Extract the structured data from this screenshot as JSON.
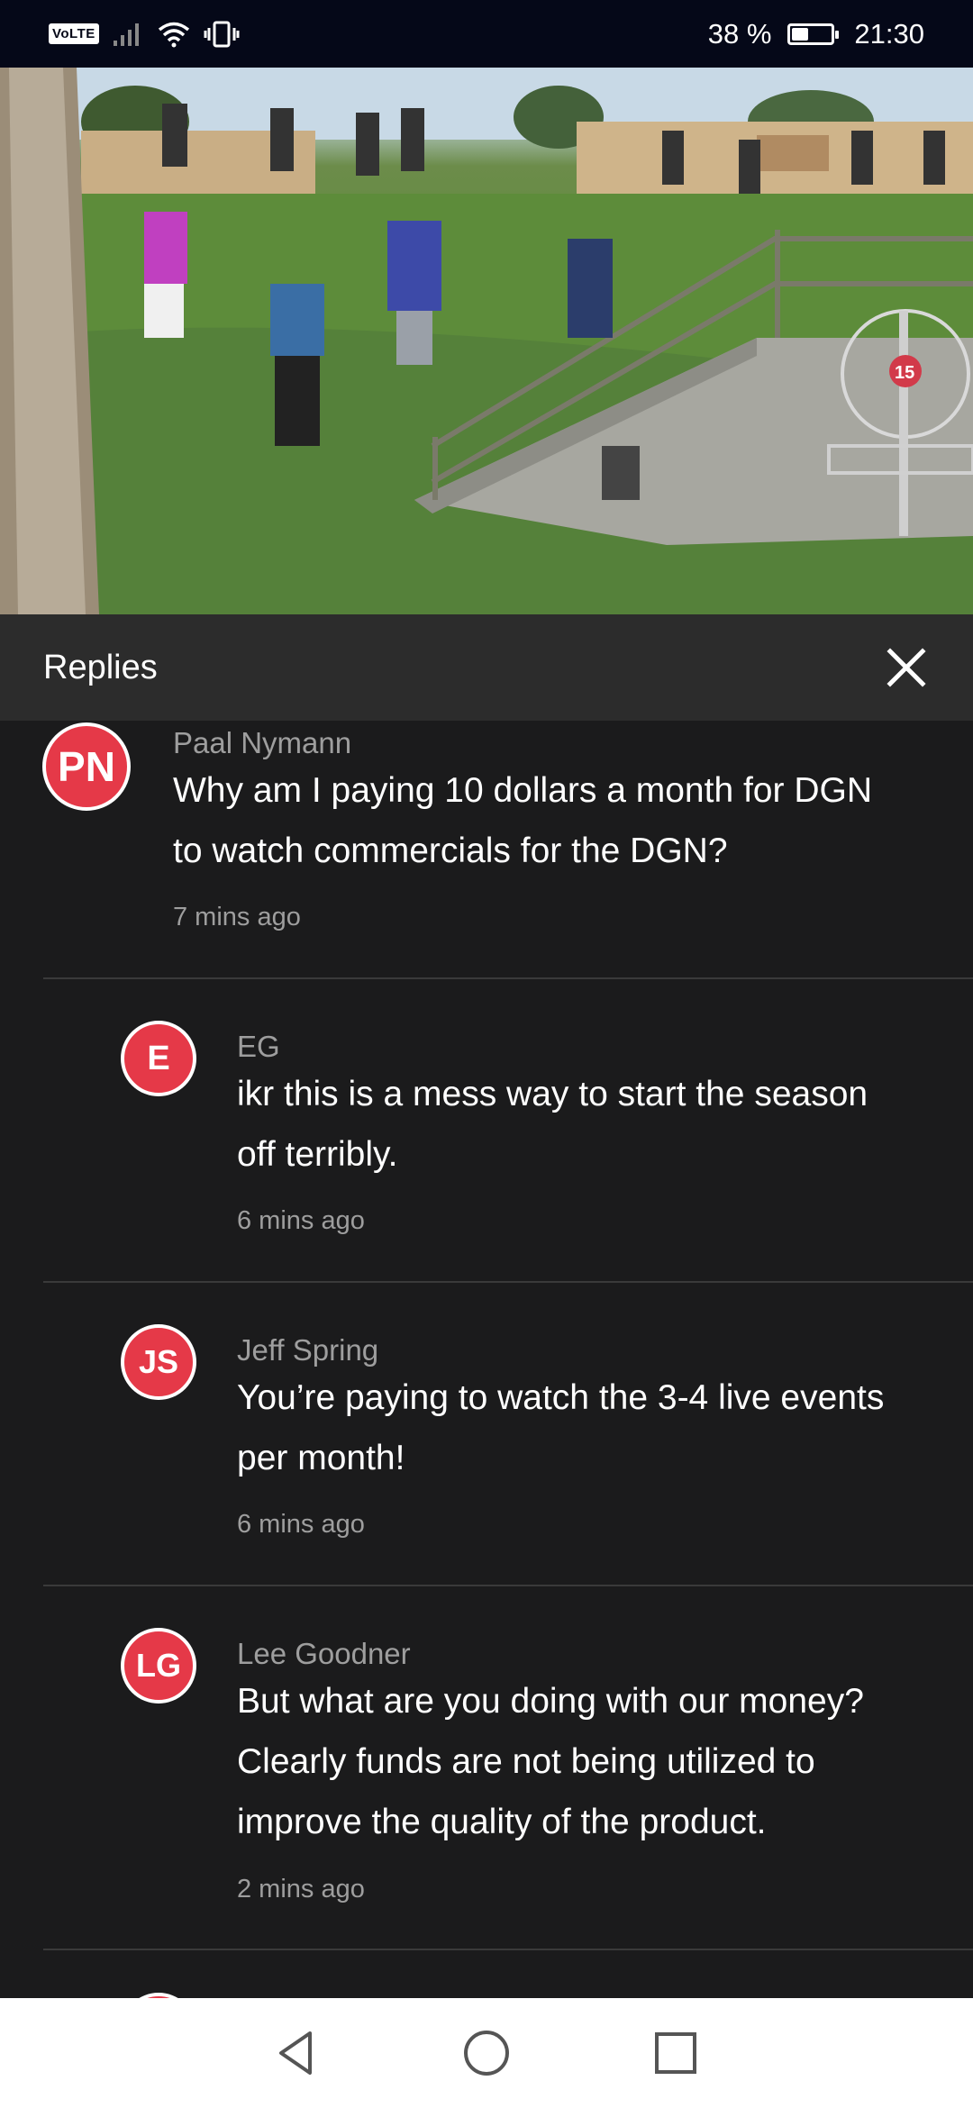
{
  "status_bar": {
    "volte": "VoLTE",
    "battery_percent_text": "38 %",
    "battery_level": 0.38,
    "time": "21:30"
  },
  "replies_panel": {
    "title": "Replies",
    "close_icon": "close-icon"
  },
  "comments": [
    {
      "initials": "PN",
      "author": "Paal Nymann",
      "text_lines": [
        "Why am I paying 10 dollars a month for DGN",
        "to watch commercials for the DGN?"
      ],
      "time": "7 mins ago"
    },
    {
      "initials": "E",
      "author": "EG",
      "text_lines": [
        "ikr this is a mess way to start the season",
        "off terribly."
      ],
      "time": "6 mins ago"
    },
    {
      "initials": "JS",
      "author": "Jeff Spring",
      "text_lines": [
        "You’re paying to watch the 3-4 live events",
        "per month!"
      ],
      "time": "6 mins ago"
    },
    {
      "initials": "LG",
      "author": "Lee Goodner",
      "text_lines": [
        "But what are you doing with our money?",
        "Clearly funds are not being utilized to",
        "improve the quality of the product."
      ],
      "time": "2 mins ago"
    }
  ],
  "video": {
    "hole_number": "15"
  },
  "nav_bar": {
    "back_icon": "back-triangle-icon",
    "home_icon": "home-circle-icon",
    "recents_icon": "recents-square-icon"
  },
  "colors": {
    "avatar": "#e53948",
    "panel_header": "#2c2c2c",
    "background": "#1b1b1c"
  }
}
